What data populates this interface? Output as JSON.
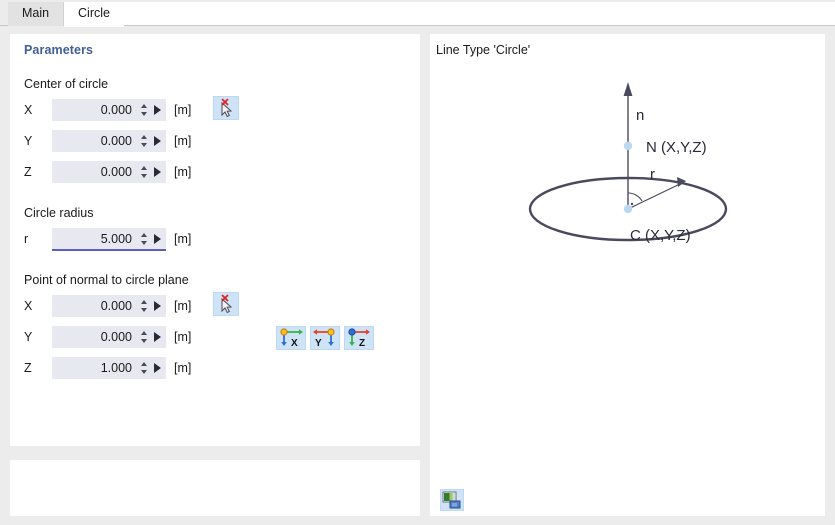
{
  "tabs": [
    {
      "label": "Main",
      "active": false
    },
    {
      "label": "Circle",
      "active": true
    }
  ],
  "parameters_panel": {
    "title": "Parameters",
    "groups": {
      "center": {
        "label": "Center of circle",
        "rows": [
          {
            "label": "X",
            "value": "0.000",
            "unit": "[m]"
          },
          {
            "label": "Y",
            "value": "0.000",
            "unit": "[m]"
          },
          {
            "label": "Z",
            "value": "0.000",
            "unit": "[m]"
          }
        ]
      },
      "radius": {
        "label": "Circle radius",
        "rows": [
          {
            "label": "r",
            "value": "5.000",
            "unit": "[m]"
          }
        ]
      },
      "normal": {
        "label": "Point of normal to circle plane",
        "rows": [
          {
            "label": "X",
            "value": "0.000",
            "unit": "[m]"
          },
          {
            "label": "Y",
            "value": "0.000",
            "unit": "[m]"
          },
          {
            "label": "Z",
            "value": "1.000",
            "unit": "[m]"
          }
        ]
      }
    },
    "buttons": {
      "pick_center": "pick-point-cursor-icon",
      "pick_normal": "pick-point-cursor-icon",
      "axis_x": "axis-x-icon",
      "axis_y": "axis-y-icon",
      "axis_z": "axis-z-icon"
    }
  },
  "graphic_panel": {
    "title": "Line Type 'Circle'",
    "screenshot_button": "screenshot-icon",
    "diagram": {
      "normal_vector_label": "n",
      "normal_point_label": "N (X,Y,Z)",
      "center_point_label": "C (X,Y,Z)",
      "radius_label": "r"
    }
  },
  "colors": {
    "accent_title": "#3f5f96",
    "field_bg": "#e8e8f0",
    "focus_underline": "#5b5fbe",
    "icon_button_bg": "#cfe3f7",
    "diagram_stroke": "#4a4a5e",
    "point_marker": "#bcd8ef",
    "axis_green": "#3bb34a",
    "axis_red": "#e8442c",
    "axis_blue": "#2b6fd4",
    "axis_yellow": "#f2c319"
  }
}
